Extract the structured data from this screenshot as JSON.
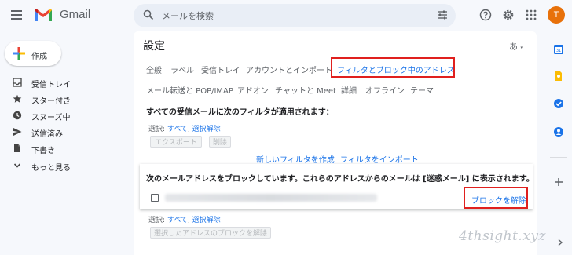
{
  "header": {
    "app_name": "Gmail",
    "search_placeholder": "メールを検索",
    "avatar_letter": "T"
  },
  "sidebar": {
    "compose_label": "作成",
    "items": [
      {
        "label": "受信トレイ",
        "icon": "inbox-icon"
      },
      {
        "label": "スター付き",
        "icon": "star-icon"
      },
      {
        "label": "スヌーズ中",
        "icon": "clock-icon"
      },
      {
        "label": "送信済み",
        "icon": "send-icon"
      },
      {
        "label": "下書き",
        "icon": "draft-icon"
      },
      {
        "label": "もっと見る",
        "icon": "chevron-down-icon"
      }
    ]
  },
  "settings": {
    "title": "設定",
    "language_indicator": "あ",
    "tabs_row1": [
      "全般",
      "ラベル",
      "受信トレイ",
      "アカウントとインポート",
      "フィルタとブロック中のアドレス"
    ],
    "tabs_row2": [
      "メール転送と POP/IMAP",
      "アドオン",
      "チャットと Meet",
      "詳細",
      "オフライン",
      "テーマ"
    ],
    "active_tab": "フィルタとブロック中のアドレス",
    "filters_heading": "すべての受信メールに次のフィルタが適用されます：",
    "select_label": "選択:",
    "select_all": "すべて",
    "select_none": "選択解除",
    "export_button": "エクスポート",
    "delete_button": "削除",
    "create_filter_link": "新しいフィルタを作成",
    "import_filter_link": "フィルタをインポート",
    "blocked_heading": "次のメールアドレスをブロックしています。これらのアドレスからのメールは [迷惑メール] に表示されます。",
    "unblock_link": "ブロックを解除",
    "unblock_selected_button": "選択したアドレスのブロックを解除"
  },
  "watermark": "4thsight.xyz",
  "colors": {
    "accent": "#1a73e8",
    "highlight_box": "#e0201e",
    "avatar": "#e8710a"
  }
}
